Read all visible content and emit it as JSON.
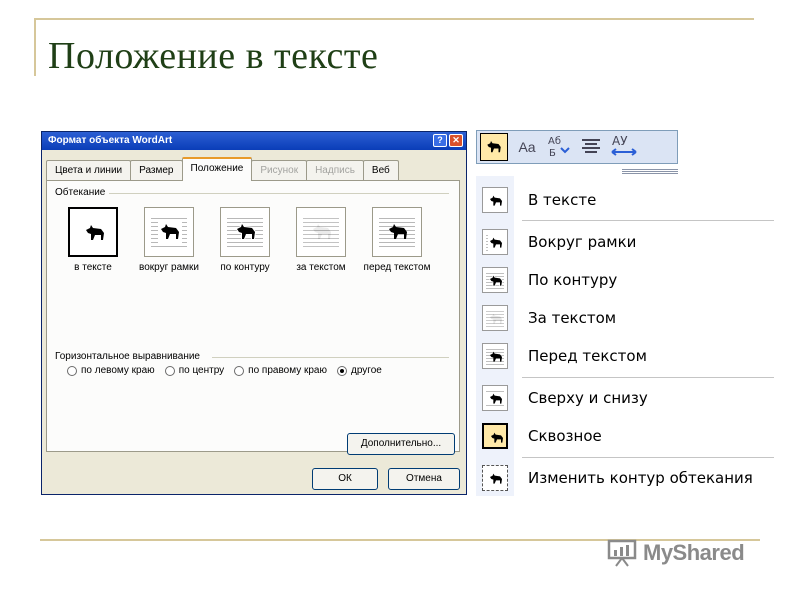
{
  "slide": {
    "title": "Положение в тексте",
    "logo_text": "MyShared"
  },
  "dialog": {
    "title": "Формат объекта WordArt",
    "tabs": [
      {
        "label": "Цвета и линии",
        "state": "enabled"
      },
      {
        "label": "Размер",
        "state": "enabled"
      },
      {
        "label": "Положение",
        "state": "active"
      },
      {
        "label": "Рисунок",
        "state": "disabled"
      },
      {
        "label": "Надпись",
        "state": "disabled"
      },
      {
        "label": "Веб",
        "state": "enabled"
      }
    ],
    "wrap_group_label": "Обтекание",
    "wrap_options": [
      {
        "label": "в тексте",
        "selected": true
      },
      {
        "label": "вокруг рамки",
        "selected": false
      },
      {
        "label": "по контуру",
        "selected": false
      },
      {
        "label": "за текстом",
        "selected": false
      },
      {
        "label": "перед текстом",
        "selected": false
      }
    ],
    "align_group_label": "Горизонтальное выравнивание",
    "align_options": [
      {
        "label": "по левому краю",
        "checked": false
      },
      {
        "label": "по центру",
        "checked": false
      },
      {
        "label": "по правому краю",
        "checked": false
      },
      {
        "label": "другое",
        "checked": true
      }
    ],
    "advanced_button": "Дополнительно...",
    "ok_button": "ОК",
    "cancel_button": "Отмена"
  },
  "toolbar": {
    "icons": [
      "wrap-icon",
      "text-same-height-icon",
      "vertical-text-icon",
      "alignment-icon",
      "character-spacing-icon"
    ]
  },
  "menu": {
    "items": [
      {
        "label": "В тексте",
        "icon": "in-line-wrap-icon",
        "selected": false
      },
      {
        "label": "Вокруг рамки",
        "icon": "square-wrap-icon",
        "selected": false
      },
      {
        "label": "По контуру",
        "icon": "tight-wrap-icon",
        "selected": false
      },
      {
        "label": "За текстом",
        "icon": "behind-text-icon",
        "selected": false
      },
      {
        "label": "Перед текстом",
        "icon": "in-front-text-icon",
        "selected": false
      },
      {
        "label": "Сверху и снизу",
        "icon": "top-bottom-wrap-icon",
        "selected": false
      },
      {
        "label": "Сквозное",
        "icon": "through-wrap-icon",
        "selected": true
      },
      {
        "label": "Изменить контур обтекания",
        "icon": "edit-wrap-points-icon",
        "selected": false
      }
    ]
  },
  "colors": {
    "title_text": "#1f3f16",
    "rule": "#d6c79a",
    "dialog_bg": "#ece9d8",
    "titlebar": "#0a3db8"
  }
}
